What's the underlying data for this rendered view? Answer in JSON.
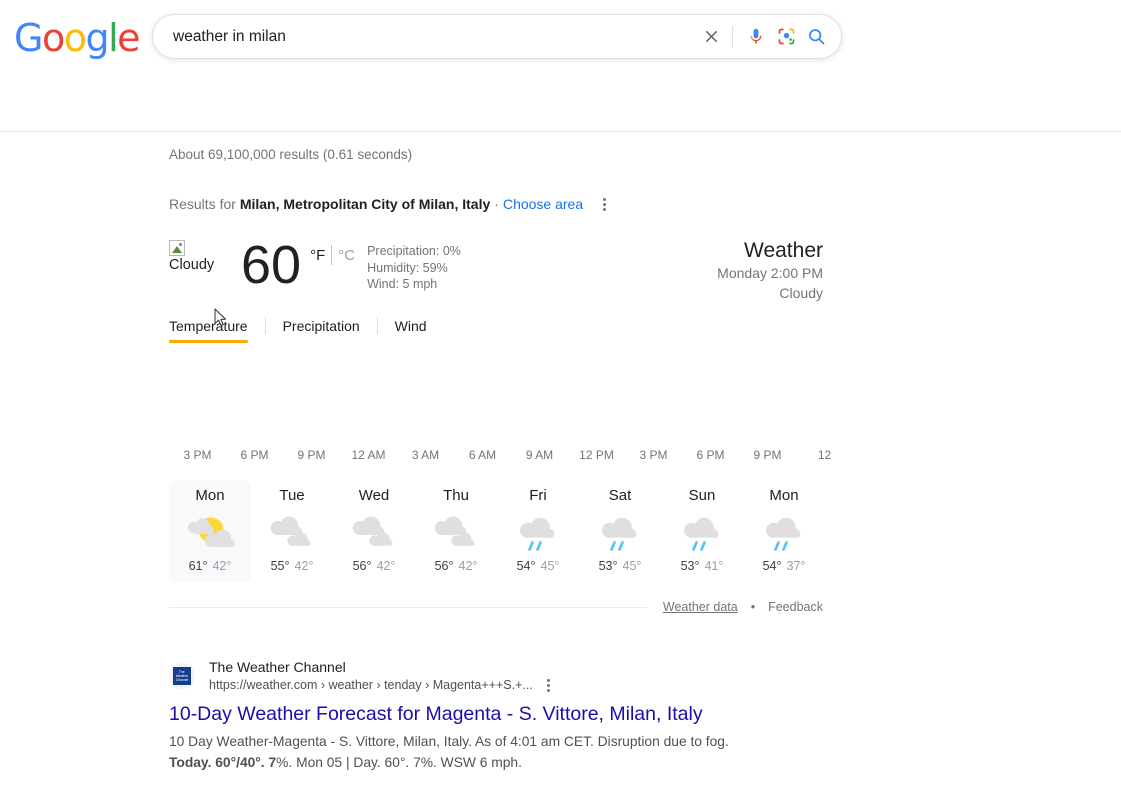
{
  "search": {
    "query": "weather in milan",
    "placeholder": "Search",
    "clear_icon": "close-icon",
    "voice_icon": "microphone-icon",
    "lens_icon": "google-lens-icon",
    "search_icon": "search-icon"
  },
  "logo": {
    "letters": [
      "G",
      "o",
      "o",
      "g",
      "l",
      "e"
    ],
    "colors": [
      "#4285F4",
      "#EA4335",
      "#FBBC05",
      "#4285F4",
      "#34A853",
      "#EA4335"
    ]
  },
  "results_stats": "About 69,100,000 results (0.61 seconds)",
  "results_for": {
    "prefix": "Results for",
    "location": "Milan, Metropolitan City of Milan, Italy",
    "separator": "·",
    "choose_area": "Choose area",
    "menu_icon": "kebab-menu-icon"
  },
  "weather": {
    "icon_alt": "Cloudy",
    "temperature": "60",
    "unit_f": "°F",
    "unit_c": "°C",
    "selected_unit": "°F",
    "precipitation": "Precipitation: 0%",
    "humidity": "Humidity: 59%",
    "wind": "Wind: 5 mph",
    "title": "Weather",
    "day_time": "Monday 2:00 PM",
    "condition": "Cloudy",
    "tabs": [
      {
        "label": "Temperature",
        "active": true
      },
      {
        "label": "Precipitation",
        "active": false
      },
      {
        "label": "Wind",
        "active": false
      }
    ],
    "hours": [
      "3 PM",
      "6 PM",
      "9 PM",
      "12 AM",
      "3 AM",
      "6 AM",
      "9 AM",
      "12 PM",
      "3 PM",
      "6 PM",
      "9 PM",
      "12"
    ],
    "days": [
      {
        "name": "Mon",
        "icon": "partly-cloudy-icon",
        "high": "61°",
        "low": "42°",
        "selected": true
      },
      {
        "name": "Tue",
        "icon": "cloudy-icon",
        "high": "55°",
        "low": "42°",
        "selected": false
      },
      {
        "name": "Wed",
        "icon": "cloudy-icon",
        "high": "56°",
        "low": "42°",
        "selected": false
      },
      {
        "name": "Thu",
        "icon": "cloudy-icon",
        "high": "56°",
        "low": "42°",
        "selected": false
      },
      {
        "name": "Fri",
        "icon": "rain-icon",
        "high": "54°",
        "low": "45°",
        "selected": false
      },
      {
        "name": "Sat",
        "icon": "rain-icon",
        "high": "53°",
        "low": "45°",
        "selected": false
      },
      {
        "name": "Sun",
        "icon": "rain-icon",
        "high": "53°",
        "low": "41°",
        "selected": false
      },
      {
        "name": "Mon",
        "icon": "rain-icon",
        "high": "54°",
        "low": "37°",
        "selected": false
      }
    ],
    "footer": {
      "weather_data": "Weather data",
      "dot": "•",
      "feedback": "Feedback"
    }
  },
  "organic_result": {
    "favicon_lines": [
      "The",
      "Weather",
      "Channel"
    ],
    "site_name": "The Weather Channel",
    "url": "https://weather.com › weather › tenday › Magenta+++S.+...",
    "menu_icon": "kebab-menu-icon",
    "title": "10-Day Weather Forecast for Magenta - S. Vittore, Milan, Italy",
    "snippet_line1": "10 Day Weather-Magenta - S. Vittore, Milan, Italy. As of 4:01 am CET. Disruption due to fog.",
    "snippet_bold": "Today. 60°/40°. 7",
    "snippet_line2": "%. Mon 05 | Day. 60°. 7%. WSW 6 mph."
  },
  "cursor": {
    "icon": "mouse-pointer-icon"
  },
  "colors": {
    "accent": "#f9ab00",
    "link": "#1a0dab",
    "blue": "#1a73e8",
    "text": "#202124",
    "muted": "#70757a"
  }
}
